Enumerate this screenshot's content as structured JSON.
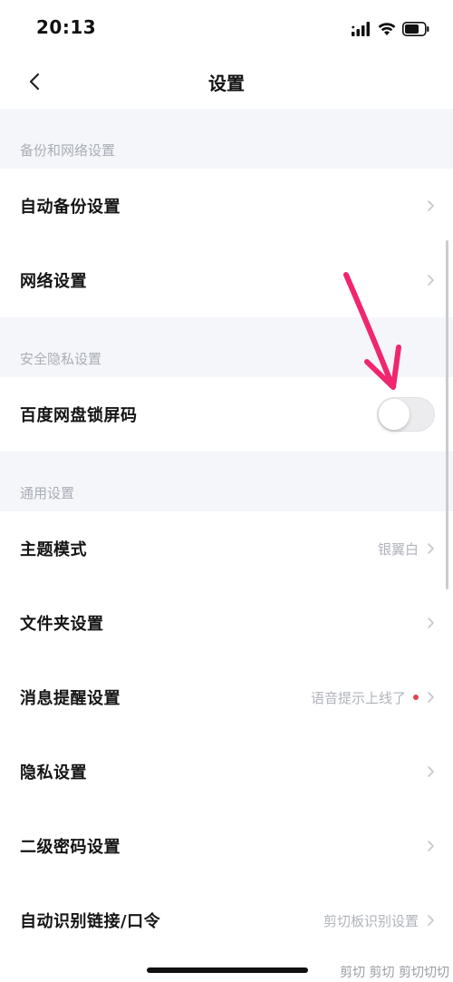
{
  "status_bar": {
    "time": "20:13"
  },
  "nav": {
    "title": "设置"
  },
  "sections": {
    "backup_network": {
      "header": "备份和网络设置",
      "items": [
        {
          "label": "自动备份设置"
        },
        {
          "label": "网络设置"
        }
      ]
    },
    "security_privacy": {
      "header": "安全隐私设置",
      "items": [
        {
          "label": "百度网盘锁屏码",
          "toggle_on": false
        }
      ]
    },
    "general": {
      "header": "通用设置",
      "items": [
        {
          "label": "主题模式",
          "value": "银翼白"
        },
        {
          "label": "文件夹设置"
        },
        {
          "label": "消息提醒设置",
          "value": "语音提示上线了",
          "dot": true
        },
        {
          "label": "隐私设置"
        },
        {
          "label": "二级密码设置"
        },
        {
          "label": "自动识别链接/口令",
          "value": "剪切板识别设置"
        }
      ]
    }
  },
  "footer": {
    "right_text": "剪切 剪切 剪切切切"
  },
  "colors": {
    "background": "#ffffff",
    "section_bg": "#f5f6f9",
    "section_text": "#a9adb6",
    "value_text": "#b0b3ba",
    "dot": "#e0454d",
    "arrow": "#f0266f"
  }
}
